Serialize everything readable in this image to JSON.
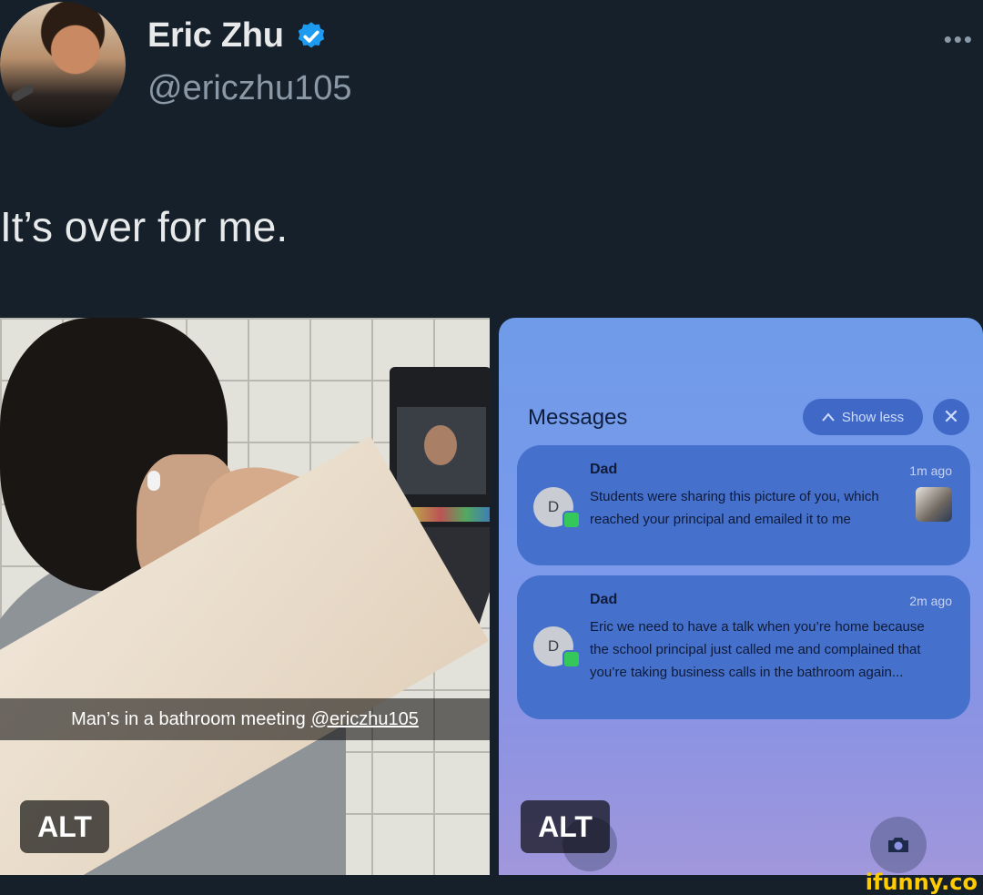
{
  "author": {
    "name": "Eric Zhu",
    "handle": "@ericzhu105",
    "verified": true,
    "verified_badge_color": "#1d9bf0"
  },
  "tweet": {
    "text": "It’s over for me.",
    "more_icon": "more-horizontal-icon"
  },
  "media": {
    "left": {
      "caption": "Man’s in a bathroom meeting",
      "caption_handle": "@ericzhu105",
      "alt_label": "ALT"
    },
    "right": {
      "alt_label": "ALT",
      "messages_title": "Messages",
      "show_less_label": "Show less",
      "notifications": [
        {
          "sender": "Dad",
          "avatar_initial": "D",
          "time": "1m ago",
          "body": "Students were sharing this picture of you, which reached your principal and emailed it to me"
        },
        {
          "sender": "Dad",
          "avatar_initial": "D",
          "time": "2m ago",
          "body": "Eric we need to have a talk when you’re home because the school principal just called me and complained that you’re taking business calls in the bathroom again..."
        }
      ]
    }
  },
  "watermark": "ifunny.co",
  "colors": {
    "background": "#15202b",
    "text_primary": "#e7e9ea",
    "text_secondary": "#8b98a5",
    "notification_bg": "#4570cc",
    "watermark": "#ffcc00"
  }
}
